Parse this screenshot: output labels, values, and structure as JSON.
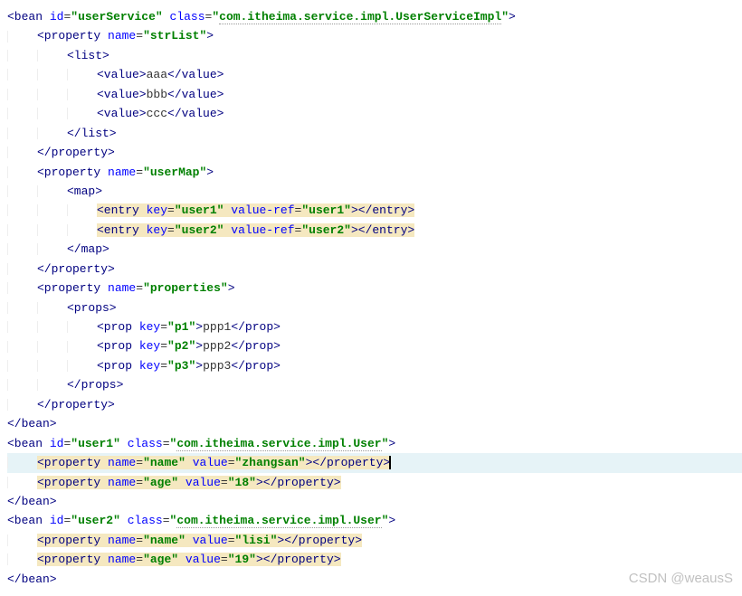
{
  "lines": [
    {
      "indent": 0,
      "html": "<span class='tag'>&lt;bean</span> <span class='attr-name'>id</span>=<span class='q'>\"</span><span class='attr-val'>userService</span><span class='q'>\"</span> <span class='attr-name'>class</span>=<span class='q'>\"</span><span class='attr-val underline-wavy'>com.itheima.service.impl.UserServiceImpl</span><span class='q'>\"</span><span class='tag'>&gt;</span>"
    },
    {
      "indent": 1,
      "html": "<span class='tag'>&lt;property</span> <span class='attr-name'>name</span>=<span class='q'>\"</span><span class='attr-val'>strList</span><span class='q'>\"</span><span class='tag'>&gt;</span>"
    },
    {
      "indent": 2,
      "html": "<span class='tag'>&lt;list&gt;</span>"
    },
    {
      "indent": 3,
      "html": "<span class='tag'>&lt;value&gt;</span><span class='text'>aaa</span><span class='tag'>&lt;/value&gt;</span>"
    },
    {
      "indent": 3,
      "html": "<span class='tag'>&lt;value&gt;</span><span class='text'>bbb</span><span class='tag'>&lt;/value&gt;</span>"
    },
    {
      "indent": 3,
      "html": "<span class='tag'>&lt;value&gt;</span><span class='text'>ccc</span><span class='tag'>&lt;/value&gt;</span>"
    },
    {
      "indent": 2,
      "html": "<span class='tag'>&lt;/list&gt;</span>"
    },
    {
      "indent": 1,
      "html": "<span class='tag'>&lt;/property&gt;</span>"
    },
    {
      "indent": 1,
      "html": "<span class='tag'>&lt;property</span> <span class='attr-name'>name</span>=<span class='q'>\"</span><span class='attr-val'>userMap</span><span class='q'>\"</span><span class='tag'>&gt;</span>"
    },
    {
      "indent": 2,
      "html": "<span class='tag'>&lt;map&gt;</span>"
    },
    {
      "indent": 3,
      "html": "<span class='hl'><span class='tag'>&lt;entry</span> <span class='attr-name'>key</span>=<span class='q'>\"</span><span class='attr-val'>user1</span><span class='q'>\"</span> <span class='attr-name'>value-ref</span>=<span class='q'>\"</span><span class='attr-val'>user1</span><span class='q'>\"</span><span class='tag'>&gt;&lt;/entry&gt;</span></span>"
    },
    {
      "indent": 3,
      "html": "<span class='hl'><span class='tag'>&lt;entry</span> <span class='attr-name'>key</span>=<span class='q'>\"</span><span class='attr-val'>user2</span><span class='q'>\"</span> <span class='attr-name'>value-ref</span>=<span class='q'>\"</span><span class='attr-val'>user2</span><span class='q'>\"</span><span class='tag'>&gt;&lt;/entry&gt;</span></span>"
    },
    {
      "indent": 2,
      "html": "<span class='tag'>&lt;/map&gt;</span>"
    },
    {
      "indent": 1,
      "html": "<span class='tag'>&lt;/property&gt;</span>"
    },
    {
      "indent": 1,
      "html": "<span class='tag'>&lt;property</span> <span class='attr-name'>name</span>=<span class='q'>\"</span><span class='attr-val'>properties</span><span class='q'>\"</span><span class='tag'>&gt;</span>"
    },
    {
      "indent": 2,
      "html": "<span class='tag'>&lt;props&gt;</span>"
    },
    {
      "indent": 3,
      "html": "<span class='tag'>&lt;prop</span> <span class='attr-name'>key</span>=<span class='q'>\"</span><span class='attr-val'>p1</span><span class='q'>\"</span><span class='tag'>&gt;</span><span class='text'>ppp1</span><span class='tag'>&lt;/prop&gt;</span>"
    },
    {
      "indent": 3,
      "html": "<span class='tag'>&lt;prop</span> <span class='attr-name'>key</span>=<span class='q'>\"</span><span class='attr-val'>p2</span><span class='q'>\"</span><span class='tag'>&gt;</span><span class='text'>ppp2</span><span class='tag'>&lt;/prop&gt;</span>"
    },
    {
      "indent": 3,
      "html": "<span class='tag'>&lt;prop</span> <span class='attr-name'>key</span>=<span class='q'>\"</span><span class='attr-val'>p3</span><span class='q'>\"</span><span class='tag'>&gt;</span><span class='text'>ppp3</span><span class='tag'>&lt;/prop&gt;</span>"
    },
    {
      "indent": 2,
      "html": "<span class='tag'>&lt;/props&gt;</span>"
    },
    {
      "indent": 1,
      "html": "<span class='tag'>&lt;/property&gt;</span>"
    },
    {
      "indent": 0,
      "html": "<span class='tag'>&lt;/bean&gt;</span>"
    },
    {
      "indent": 0,
      "html": "<span class='tag'>&lt;bean</span> <span class='attr-name'>id</span>=<span class='q'>\"</span><span class='attr-val'>user1</span><span class='q'>\"</span> <span class='attr-name'>class</span>=<span class='q'>\"</span><span class='attr-val underline-wavy'>com.itheima.service.impl.User</span><span class='q'>\"</span><span class='tag'>&gt;</span>"
    },
    {
      "indent": 1,
      "caret": true,
      "html": "<span class='hl'><span class='tag'>&lt;property</span> <span class='attr-name'>name</span>=<span class='q'>\"</span><span class='attr-val'>name</span><span class='q'>\"</span> <span class='attr-name'>value</span>=<span class='q'>\"</span><span class='attr-val'>zhangsan</span><span class='q'>\"</span><span class='tag'>&gt;&lt;/property&gt;</span></span>"
    },
    {
      "indent": 1,
      "html": "<span class='hl'><span class='tag'>&lt;property</span> <span class='attr-name'>name</span>=<span class='q'>\"</span><span class='attr-val'>age</span><span class='q'>\"</span> <span class='attr-name'>value</span>=<span class='q'>\"</span><span class='attr-val'>18</span><span class='q'>\"</span><span class='tag'>&gt;&lt;/property&gt;</span></span>"
    },
    {
      "indent": 0,
      "html": "<span class='tag'>&lt;/bean&gt;</span>"
    },
    {
      "indent": 0,
      "html": "<span class='tag'>&lt;bean</span> <span class='attr-name'>id</span>=<span class='q'>\"</span><span class='attr-val'>user2</span><span class='q'>\"</span> <span class='attr-name'>class</span>=<span class='q'>\"</span><span class='attr-val underline-wavy'>com.itheima.service.impl.User</span><span class='q'>\"</span><span class='tag'>&gt;</span>"
    },
    {
      "indent": 1,
      "html": "<span class='hl'><span class='tag'>&lt;property</span> <span class='attr-name'>name</span>=<span class='q'>\"</span><span class='attr-val'>name</span><span class='q'>\"</span> <span class='attr-name'>value</span>=<span class='q'>\"</span><span class='attr-val'>lisi</span><span class='q'>\"</span><span class='tag'>&gt;&lt;/property&gt;</span></span>"
    },
    {
      "indent": 1,
      "html": "<span class='hl'><span class='tag'>&lt;property</span> <span class='attr-name'>name</span>=<span class='q'>\"</span><span class='attr-val'>age</span><span class='q'>\"</span> <span class='attr-name'>value</span>=<span class='q'>\"</span><span class='attr-val'>19</span><span class='q'>\"</span><span class='tag'>&gt;&lt;/property&gt;</span></span>"
    },
    {
      "indent": 0,
      "html": "<span class='tag'>&lt;/bean&gt;</span>"
    }
  ],
  "watermark": "CSDN @weausS"
}
